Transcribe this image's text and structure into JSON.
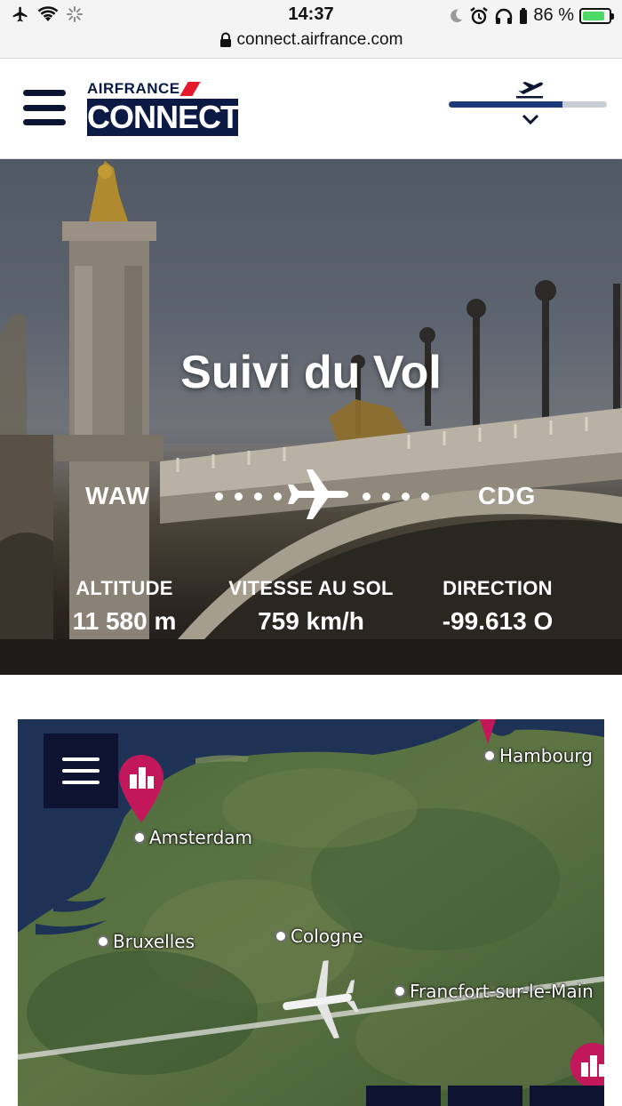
{
  "status_bar": {
    "time": "14:37",
    "battery_text": "86 %",
    "battery_level": 0.86,
    "url": "connect.airfrance.com",
    "icons": [
      "airplane-mode-icon",
      "wifi-icon",
      "loading-icon",
      "moon-icon",
      "alarm-icon",
      "headphones-icon",
      "battery-icon",
      "lock-icon"
    ]
  },
  "header": {
    "brand_top": "AIRFRANCE",
    "brand_bottom": "CONNECT",
    "flight_progress": 0.72,
    "colors": {
      "navy": "#0b1a45",
      "red": "#e3182d",
      "progress": "#1c3a7a"
    }
  },
  "hero": {
    "title": "Suivi du Vol",
    "origin": "WAW",
    "destination": "CDG",
    "stats": [
      {
        "label": "ALTITUDE",
        "value": "11 580 m"
      },
      {
        "label": "VITESSE AU SOL",
        "value": "759 km/h"
      },
      {
        "label": "DIRECTION",
        "value": "-99.613 O"
      }
    ]
  },
  "map": {
    "cities": [
      {
        "name": "Amsterdam"
      },
      {
        "name": "Hambourg"
      },
      {
        "name": "Bruxelles"
      },
      {
        "name": "Cologne"
      },
      {
        "name": "Francfort-sur-le-Main"
      }
    ],
    "pin_color": "#c2185b",
    "menu_color": "#0d1330"
  }
}
